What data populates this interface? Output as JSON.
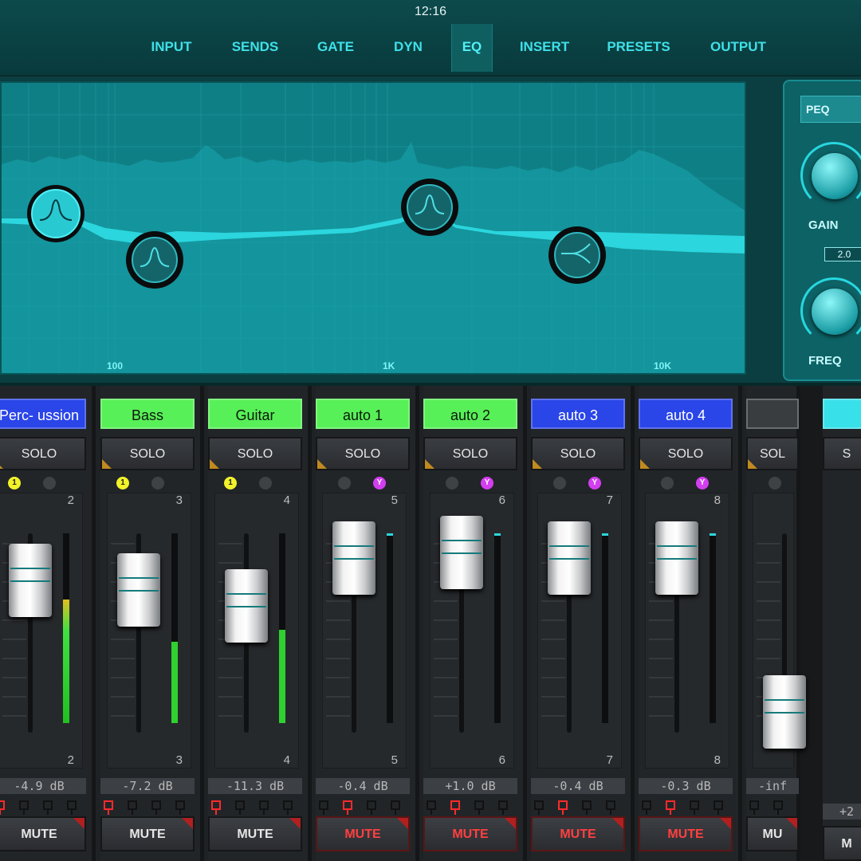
{
  "status_bar": {
    "time": "12:16"
  },
  "tabs": [
    {
      "label": "INPUT",
      "active": false
    },
    {
      "label": "SENDS",
      "active": false
    },
    {
      "label": "GATE",
      "active": false
    },
    {
      "label": "DYN",
      "active": false
    },
    {
      "label": "EQ",
      "active": true
    },
    {
      "label": "INSERT",
      "active": false
    },
    {
      "label": "PRESETS",
      "active": false
    },
    {
      "label": "OUTPUT",
      "active": false
    }
  ],
  "eq": {
    "freq_labels": [
      "100",
      "1K",
      "10K"
    ],
    "panel": {
      "mode": "PEQ",
      "gain_label": "GAIN",
      "gain_value": "2.0",
      "freq_label": "FREQ"
    },
    "bands": [
      {
        "type": "peak"
      },
      {
        "type": "peak"
      },
      {
        "type": "peak"
      },
      {
        "type": "shelf"
      }
    ]
  },
  "channels": [
    {
      "name": "Perc- ussion",
      "color": "blue",
      "number": "2",
      "solo": "SOLO",
      "mute": "MUTE",
      "db": "-4.9 dB",
      "muted": false,
      "badge": "1",
      "badge_color": "yellow",
      "meter_level": 0.65,
      "fader_level": 0.74,
      "sq_red": 0
    },
    {
      "name": "Bass",
      "color": "green",
      "number": "3",
      "solo": "SOLO",
      "mute": "MUTE",
      "db": "-7.2 dB",
      "muted": false,
      "badge": "1",
      "badge_color": "yellow",
      "meter_level": 0.43,
      "fader_level": 0.69,
      "sq_red": 0
    },
    {
      "name": "Guitar",
      "color": "green",
      "number": "4",
      "solo": "SOLO",
      "mute": "MUTE",
      "db": "-11.3 dB",
      "muted": false,
      "badge": "1",
      "badge_color": "yellow",
      "meter_level": 0.49,
      "fader_level": 0.61,
      "sq_red": 0
    },
    {
      "name": "auto 1",
      "color": "green",
      "number": "5",
      "solo": "SOLO",
      "mute": "MUTE",
      "db": "-0.4 dB",
      "muted": true,
      "badge": "Y",
      "badge_color": "magenta",
      "meter_level": 0.0,
      "fader_level": 0.85,
      "sq_red": 1
    },
    {
      "name": "auto 2",
      "color": "green",
      "number": "6",
      "solo": "SOLO",
      "mute": "MUTE",
      "db": "+1.0 dB",
      "muted": true,
      "badge": "Y",
      "badge_color": "magenta",
      "meter_level": 0.0,
      "fader_level": 0.88,
      "sq_red": 1
    },
    {
      "name": "auto 3",
      "color": "blue",
      "number": "7",
      "solo": "SOLO",
      "mute": "MUTE",
      "db": "-0.4 dB",
      "muted": true,
      "badge": "Y",
      "badge_color": "magenta",
      "meter_level": 0.0,
      "fader_level": 0.85,
      "sq_red": 1
    },
    {
      "name": "auto 4",
      "color": "blue",
      "number": "8",
      "solo": "SOLO",
      "mute": "MUTE",
      "db": "-0.3 dB",
      "muted": true,
      "badge": "Y",
      "badge_color": "magenta",
      "meter_level": 0.0,
      "fader_level": 0.85,
      "sq_red": 1
    },
    {
      "name": "",
      "color": "dark",
      "number": "",
      "solo": "SOL",
      "mute": "MU",
      "db": "-inf",
      "muted": false,
      "badge": "",
      "badge_color": "grey",
      "meter_level": 0.0,
      "fader_level": 0.08,
      "sq_red": -1
    }
  ],
  "partial_channel": {
    "name": "",
    "solo": "S",
    "mute": "M",
    "db": "+2"
  },
  "colors": {
    "accent": "#3fe0e8",
    "eq_background": "#0f7f86",
    "name_blue": "#2a45e8",
    "name_green": "#58f058",
    "mute_active": "#ff4040"
  }
}
